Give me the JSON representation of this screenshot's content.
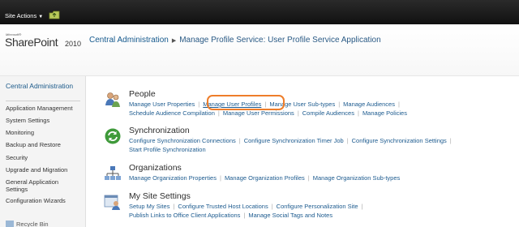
{
  "ribbon": {
    "site_actions": "Site Actions"
  },
  "logo": {
    "microsoft": "Microsoft®",
    "product": "SharePoint",
    "version": "2010"
  },
  "breadcrumb": {
    "root": "Central Administration",
    "current": "Manage Profile Service: User Profile Service Application"
  },
  "leftnav": {
    "header": "Central Administration",
    "items": [
      "Application Management",
      "System Settings",
      "Monitoring",
      "Backup and Restore",
      "Security",
      "Upgrade and Migration",
      "General Application Settings",
      "Configuration Wizards"
    ],
    "bottom": "Recycle Bin"
  },
  "sections": {
    "people": {
      "title": "People",
      "icon": "people-icon",
      "row1": [
        "Manage User Properties",
        "Manage User Profiles",
        "Manage User Sub-types",
        "Manage Audiences"
      ],
      "row2": [
        "Schedule Audience Compilation",
        "Manage User Permissions",
        "Compile Audiences",
        "Manage Policies"
      ]
    },
    "sync": {
      "title": "Synchronization",
      "icon": "sync-icon",
      "row1": [
        "Configure Synchronization Connections",
        "Configure Synchronization Timer Job",
        "Configure Synchronization Settings"
      ],
      "row2": [
        "Start Profile Synchronization"
      ]
    },
    "orgs": {
      "title": "Organizations",
      "icon": "org-chart-icon",
      "row1": [
        "Manage Organization Properties",
        "Manage Organization Profiles",
        "Manage Organization Sub-types"
      ]
    },
    "mysite": {
      "title": "My Site Settings",
      "icon": "my-site-icon",
      "row1": [
        "Setup My Sites",
        "Configure Trusted Host Locations",
        "Configure Personalization Site"
      ],
      "row2": [
        "Publish Links to Office Client Applications",
        "Manage Social Tags and Notes"
      ]
    }
  },
  "colors": {
    "link": "#1d5b8f",
    "highlight": "#ee7d2a",
    "ribbon": "#1a1a1a"
  }
}
